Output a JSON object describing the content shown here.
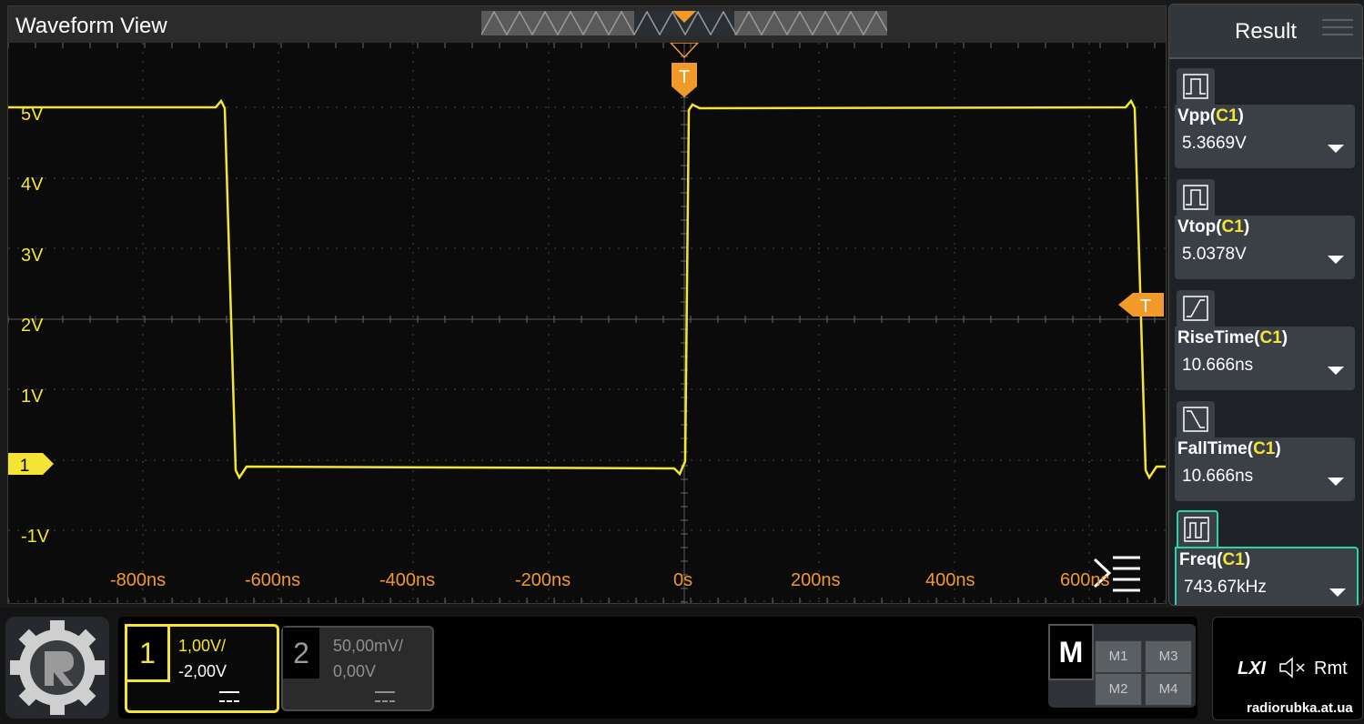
{
  "waveform_view": {
    "title": "Waveform View",
    "y_labels": [
      "5V",
      "4V",
      "3V",
      "2V",
      "1V",
      "-1V"
    ],
    "x_labels": [
      "-800ns",
      "-600ns",
      "-400ns",
      "-200ns",
      "0s",
      "200ns",
      "400ns",
      "600ns"
    ],
    "trigger_label": "T",
    "trigger_level_label": "T",
    "channel1_marker": "1",
    "trace_color": "#f4e534",
    "trigger_color": "#f19a2a"
  },
  "result_panel": {
    "title": "Result",
    "measurements": [
      {
        "name": "Vpp",
        "channel": "C1",
        "value": "5.3669V",
        "icon": "pulse-icon"
      },
      {
        "name": "Vtop",
        "channel": "C1",
        "value": "5.0378V",
        "icon": "pulse-icon"
      },
      {
        "name": "RiseTime",
        "channel": "C1",
        "value": "10.666ns",
        "icon": "rise-edge-icon"
      },
      {
        "name": "FallTime",
        "channel": "C1",
        "value": "10.666ns",
        "icon": "fall-edge-icon"
      },
      {
        "name": "Freq",
        "channel": "C1",
        "value": "743.67kHz",
        "icon": "frequency-icon"
      }
    ],
    "accent_color": "#2bd4a6"
  },
  "channels": {
    "ch1": {
      "number": "1",
      "scale": "1,00V/",
      "offset": "-2,00V",
      "color": "#f4e534"
    },
    "ch2": {
      "number": "2",
      "scale": "50,00mV/",
      "offset": "0,00V"
    }
  },
  "math": {
    "label": "M",
    "buttons": [
      "M1",
      "M3",
      "M2",
      "M4"
    ]
  },
  "status": {
    "lxi": "LXI",
    "remote": "Rmt",
    "watermark": "radiorubka.at.ua"
  }
}
